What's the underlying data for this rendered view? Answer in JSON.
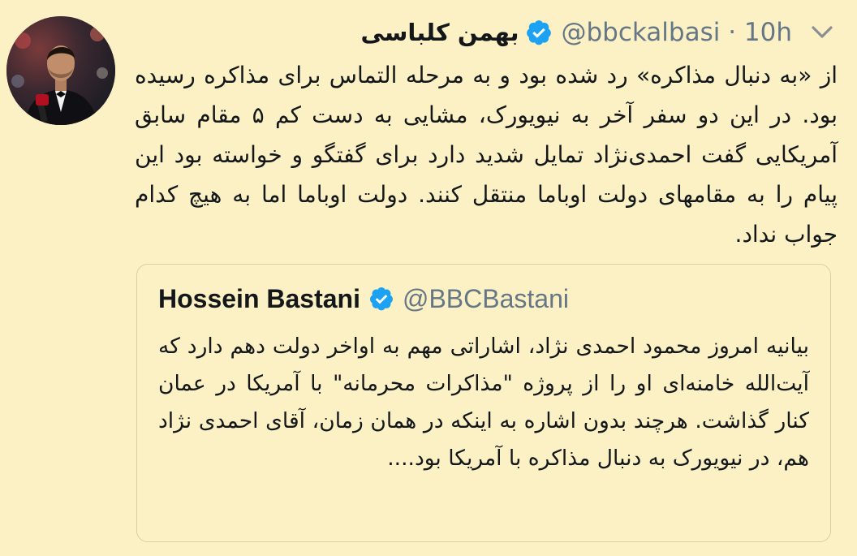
{
  "tweet": {
    "author_name": "بهمن کلباسی",
    "handle": "@bbckalbasi",
    "time": "10h",
    "text": "از «به دنبال مذاکره» رد شده بود و به مرحله التماس برای مذاکره رسیده بود. در این دو سفر آخر به نیویورک، مشایی به دست کم ۵ مقام سابق آمریکایی گفت احمدی‌نژاد تمایل شدید دارد برای گفتگو و خواسته بود این پیام را به مقامهای دولت اوباما منتقل کنند. دولت اوباما اما به هیچ کدام جواب نداد.",
    "avatar_icon": "profile-photo",
    "verified_icon": "verified-badge-icon",
    "menu_icon": "chevron-down-icon"
  },
  "quoted_tweet": {
    "author_name": "Hossein Bastani",
    "handle": "@BBCBastani",
    "text": "بیانیه امروز محمود احمدی نژاد، اشاراتی مهم به اواخر دولت دهم دارد که آیت‌الله خامنه‌ای او را از پروژه \"مذاکرات محرمانه\" با آمریکا در عمان کنار گذاشت. هرچند بدون اشاره به اینکه در همان زمان، آقای احمدی نژاد هم، در نیویورک به دنبال مذاکره با آمریکا بود...."
  },
  "colors": {
    "background": "#fbf1c4",
    "verified_blue": "#1da1f2",
    "secondary_text": "#657786",
    "border": "#d6cfa8"
  }
}
